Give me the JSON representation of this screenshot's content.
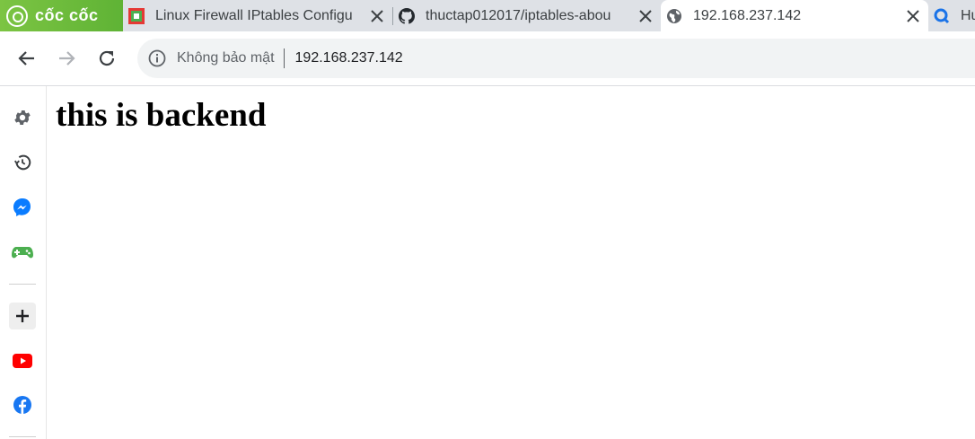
{
  "browser": {
    "brand": {
      "name": "cốc cốc"
    },
    "tabs": [
      {
        "title": "Linux Firewall IPtables Configu",
        "favicon": "square-favicon-icon",
        "active": false
      },
      {
        "title": "thuctap012017/iptables-abou",
        "favicon": "github-icon",
        "active": false
      },
      {
        "title": "192.168.237.142",
        "favicon": "globe-icon",
        "active": true
      },
      {
        "title": "Hu",
        "favicon": "coccoc-search-icon",
        "active": false
      }
    ],
    "toolbar": {
      "back_icon": "back-arrow-icon",
      "forward_icon": "forward-arrow-icon",
      "reload_icon": "reload-icon",
      "security_label": "Không bảo mật",
      "url": "192.168.237.142"
    },
    "sidebar": {
      "items": [
        "settings-icon",
        "history-icon",
        "messenger-icon",
        "game-icon",
        "add-icon",
        "youtube-icon",
        "facebook-icon"
      ]
    }
  },
  "page": {
    "heading": "this is backend"
  },
  "colors": {
    "brand_green": "#6cbb3c",
    "tab_strip": "#dee1e6",
    "omnibox": "#f1f3f4",
    "messenger": "#0a7cff",
    "youtube": "#ff0000",
    "facebook": "#1877f2",
    "game": "#4caf50"
  }
}
